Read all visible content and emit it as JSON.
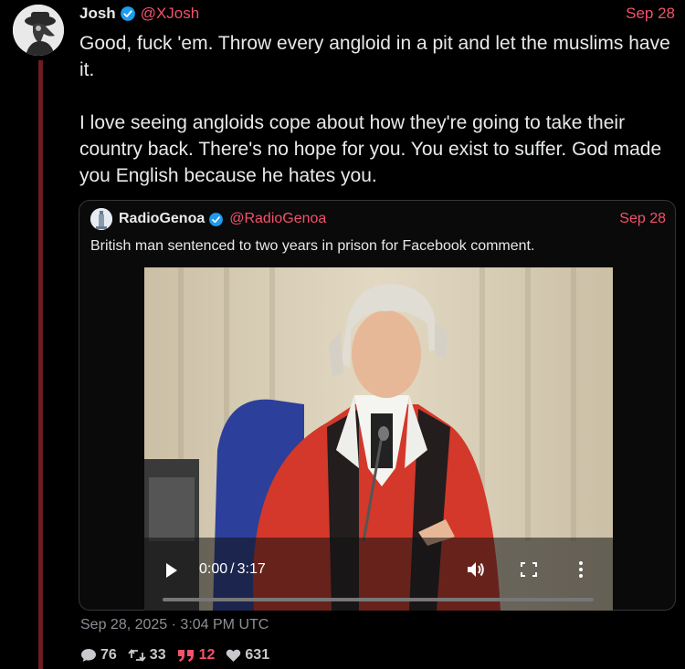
{
  "post": {
    "display_name": "Josh",
    "handle": "@XJosh",
    "date": "Sep 28",
    "paragraphs": [
      "Good, fuck 'em. Throw every angloid in a pit and let the muslims have it.",
      "I love seeing angloids cope about how they're going to take their country back. There's no hope for you. You exist to suffer. God made you English because he hates you."
    ],
    "avatar_icon": "plague-doctor-avatar-icon",
    "timestamp": "Sep 28, 2025 · 3:04 PM UTC",
    "stats": {
      "replies": "76",
      "reposts": "33",
      "quotes": "12",
      "likes": "631"
    }
  },
  "quoted": {
    "display_name": "RadioGenoa",
    "handle": "@RadioGenoa",
    "date": "Sep 28",
    "text": "British man sentenced to two years in prison for Facebook comment.",
    "video": {
      "current_time": "0:00",
      "separator": "/",
      "duration": "3:17",
      "progress": 0
    }
  },
  "colors": {
    "accent": "#f4516c",
    "thread_line": "#6b1d20",
    "verified": "#1d9bf0",
    "background": "#000000"
  }
}
